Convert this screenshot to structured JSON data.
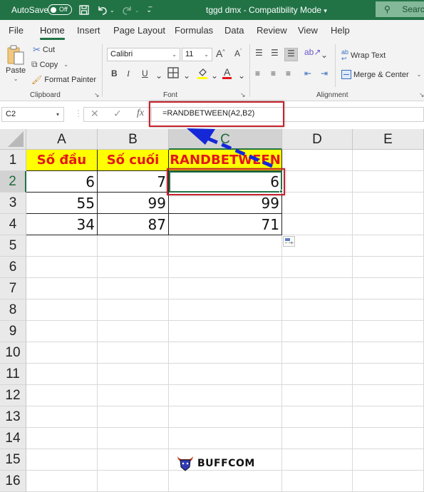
{
  "titlebar": {
    "autosave_label": "AutoSave",
    "autosave_state": "Off",
    "document_title": "tggd dmx  -  Compatibility Mode",
    "title_dropdown": "▾",
    "search_placeholder": "Search",
    "icons": [
      "save-icon",
      "undo-icon",
      "redo-icon",
      "customize-qat-icon"
    ],
    "accent_color": "#217346"
  },
  "tabs": [
    {
      "label": "File",
      "active": false
    },
    {
      "label": "Home",
      "active": true
    },
    {
      "label": "Insert",
      "active": false
    },
    {
      "label": "Page Layout",
      "active": false
    },
    {
      "label": "Formulas",
      "active": false
    },
    {
      "label": "Data",
      "active": false
    },
    {
      "label": "Review",
      "active": false
    },
    {
      "label": "View",
      "active": false
    },
    {
      "label": "Help",
      "active": false
    }
  ],
  "ribbon": {
    "clipboard": {
      "paste": "Paste",
      "cut": "Cut",
      "copy": "Copy",
      "format_painter": "Format Painter",
      "label": "Clipboard"
    },
    "font": {
      "font_name": "Calibri",
      "font_size": "11",
      "bold": "B",
      "italic": "I",
      "underline": "U",
      "grow": "A",
      "shrink": "A",
      "font_color_glyph": "A",
      "fill_color": "#ffff00",
      "font_color": "#e3161b",
      "label": "Font"
    },
    "alignment": {
      "wrap_text": "Wrap Text",
      "merge_center": "Merge & Center",
      "label": "Alignment"
    }
  },
  "formula_bar": {
    "name_box": "C2",
    "cancel": "✕",
    "enter": "✓",
    "fx": "fx",
    "formula": "=RANDBETWEEN(A2,B2)"
  },
  "sheet": {
    "columns": [
      "A",
      "B",
      "C",
      "D",
      "E"
    ],
    "rows": [
      "1",
      "2",
      "3",
      "4",
      "5",
      "6",
      "7",
      "8",
      "9",
      "10",
      "11",
      "12",
      "13",
      "14",
      "15",
      "16"
    ],
    "selected_cell": "C2",
    "header_row": [
      "Số đầu",
      "Số cuối",
      "RANDBETWEEN"
    ],
    "data_rows": [
      [
        "6",
        "7",
        "6"
      ],
      [
        "55",
        "99",
        "99"
      ],
      [
        "34",
        "87",
        "71"
      ]
    ],
    "header_fill": "#ffff00",
    "header_text_color": "#e3161b",
    "highlight_color": "#c8222b",
    "arrow_color": "#1428d8"
  },
  "watermark": {
    "text": "BUFFCOM"
  }
}
